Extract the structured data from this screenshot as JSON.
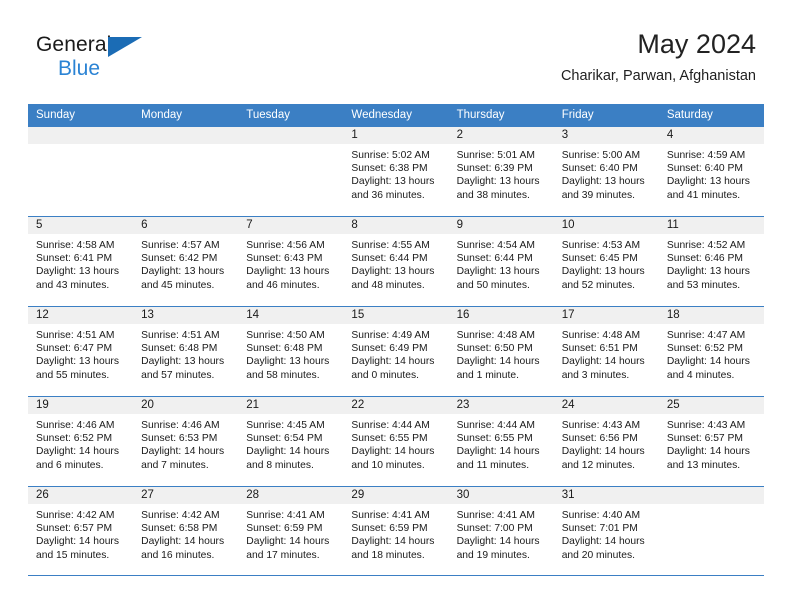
{
  "brand": {
    "name_top": "General",
    "name_bottom": "Blue",
    "accent_color": "#2b83d4",
    "triangle_color": "#1b6cb5"
  },
  "header": {
    "title": "May 2024",
    "subtitle": "Charikar, Parwan, Afghanistan"
  },
  "theme": {
    "header_band": "#3b7fc4",
    "day_head_band": "#f0f0f0",
    "text": "#1a1a1a"
  },
  "weekdays": [
    "Sunday",
    "Monday",
    "Tuesday",
    "Wednesday",
    "Thursday",
    "Friday",
    "Saturday"
  ],
  "weeks": [
    [
      {
        "day": "",
        "empty": true
      },
      {
        "day": "",
        "empty": true
      },
      {
        "day": "",
        "empty": true
      },
      {
        "day": "1",
        "sunrise": "Sunrise: 5:02 AM",
        "sunset": "Sunset: 6:38 PM",
        "daylight": "Daylight: 13 hours and 36 minutes."
      },
      {
        "day": "2",
        "sunrise": "Sunrise: 5:01 AM",
        "sunset": "Sunset: 6:39 PM",
        "daylight": "Daylight: 13 hours and 38 minutes."
      },
      {
        "day": "3",
        "sunrise": "Sunrise: 5:00 AM",
        "sunset": "Sunset: 6:40 PM",
        "daylight": "Daylight: 13 hours and 39 minutes."
      },
      {
        "day": "4",
        "sunrise": "Sunrise: 4:59 AM",
        "sunset": "Sunset: 6:40 PM",
        "daylight": "Daylight: 13 hours and 41 minutes."
      }
    ],
    [
      {
        "day": "5",
        "sunrise": "Sunrise: 4:58 AM",
        "sunset": "Sunset: 6:41 PM",
        "daylight": "Daylight: 13 hours and 43 minutes."
      },
      {
        "day": "6",
        "sunrise": "Sunrise: 4:57 AM",
        "sunset": "Sunset: 6:42 PM",
        "daylight": "Daylight: 13 hours and 45 minutes."
      },
      {
        "day": "7",
        "sunrise": "Sunrise: 4:56 AM",
        "sunset": "Sunset: 6:43 PM",
        "daylight": "Daylight: 13 hours and 46 minutes."
      },
      {
        "day": "8",
        "sunrise": "Sunrise: 4:55 AM",
        "sunset": "Sunset: 6:44 PM",
        "daylight": "Daylight: 13 hours and 48 minutes."
      },
      {
        "day": "9",
        "sunrise": "Sunrise: 4:54 AM",
        "sunset": "Sunset: 6:44 PM",
        "daylight": "Daylight: 13 hours and 50 minutes."
      },
      {
        "day": "10",
        "sunrise": "Sunrise: 4:53 AM",
        "sunset": "Sunset: 6:45 PM",
        "daylight": "Daylight: 13 hours and 52 minutes."
      },
      {
        "day": "11",
        "sunrise": "Sunrise: 4:52 AM",
        "sunset": "Sunset: 6:46 PM",
        "daylight": "Daylight: 13 hours and 53 minutes."
      }
    ],
    [
      {
        "day": "12",
        "sunrise": "Sunrise: 4:51 AM",
        "sunset": "Sunset: 6:47 PM",
        "daylight": "Daylight: 13 hours and 55 minutes."
      },
      {
        "day": "13",
        "sunrise": "Sunrise: 4:51 AM",
        "sunset": "Sunset: 6:48 PM",
        "daylight": "Daylight: 13 hours and 57 minutes."
      },
      {
        "day": "14",
        "sunrise": "Sunrise: 4:50 AM",
        "sunset": "Sunset: 6:48 PM",
        "daylight": "Daylight: 13 hours and 58 minutes."
      },
      {
        "day": "15",
        "sunrise": "Sunrise: 4:49 AM",
        "sunset": "Sunset: 6:49 PM",
        "daylight": "Daylight: 14 hours and 0 minutes."
      },
      {
        "day": "16",
        "sunrise": "Sunrise: 4:48 AM",
        "sunset": "Sunset: 6:50 PM",
        "daylight": "Daylight: 14 hours and 1 minute."
      },
      {
        "day": "17",
        "sunrise": "Sunrise: 4:48 AM",
        "sunset": "Sunset: 6:51 PM",
        "daylight": "Daylight: 14 hours and 3 minutes."
      },
      {
        "day": "18",
        "sunrise": "Sunrise: 4:47 AM",
        "sunset": "Sunset: 6:52 PM",
        "daylight": "Daylight: 14 hours and 4 minutes."
      }
    ],
    [
      {
        "day": "19",
        "sunrise": "Sunrise: 4:46 AM",
        "sunset": "Sunset: 6:52 PM",
        "daylight": "Daylight: 14 hours and 6 minutes."
      },
      {
        "day": "20",
        "sunrise": "Sunrise: 4:46 AM",
        "sunset": "Sunset: 6:53 PM",
        "daylight": "Daylight: 14 hours and 7 minutes."
      },
      {
        "day": "21",
        "sunrise": "Sunrise: 4:45 AM",
        "sunset": "Sunset: 6:54 PM",
        "daylight": "Daylight: 14 hours and 8 minutes."
      },
      {
        "day": "22",
        "sunrise": "Sunrise: 4:44 AM",
        "sunset": "Sunset: 6:55 PM",
        "daylight": "Daylight: 14 hours and 10 minutes."
      },
      {
        "day": "23",
        "sunrise": "Sunrise: 4:44 AM",
        "sunset": "Sunset: 6:55 PM",
        "daylight": "Daylight: 14 hours and 11 minutes."
      },
      {
        "day": "24",
        "sunrise": "Sunrise: 4:43 AM",
        "sunset": "Sunset: 6:56 PM",
        "daylight": "Daylight: 14 hours and 12 minutes."
      },
      {
        "day": "25",
        "sunrise": "Sunrise: 4:43 AM",
        "sunset": "Sunset: 6:57 PM",
        "daylight": "Daylight: 14 hours and 13 minutes."
      }
    ],
    [
      {
        "day": "26",
        "sunrise": "Sunrise: 4:42 AM",
        "sunset": "Sunset: 6:57 PM",
        "daylight": "Daylight: 14 hours and 15 minutes."
      },
      {
        "day": "27",
        "sunrise": "Sunrise: 4:42 AM",
        "sunset": "Sunset: 6:58 PM",
        "daylight": "Daylight: 14 hours and 16 minutes."
      },
      {
        "day": "28",
        "sunrise": "Sunrise: 4:41 AM",
        "sunset": "Sunset: 6:59 PM",
        "daylight": "Daylight: 14 hours and 17 minutes."
      },
      {
        "day": "29",
        "sunrise": "Sunrise: 4:41 AM",
        "sunset": "Sunset: 6:59 PM",
        "daylight": "Daylight: 14 hours and 18 minutes."
      },
      {
        "day": "30",
        "sunrise": "Sunrise: 4:41 AM",
        "sunset": "Sunset: 7:00 PM",
        "daylight": "Daylight: 14 hours and 19 minutes."
      },
      {
        "day": "31",
        "sunrise": "Sunrise: 4:40 AM",
        "sunset": "Sunset: 7:01 PM",
        "daylight": "Daylight: 14 hours and 20 minutes."
      },
      {
        "day": "",
        "empty": true
      }
    ]
  ]
}
